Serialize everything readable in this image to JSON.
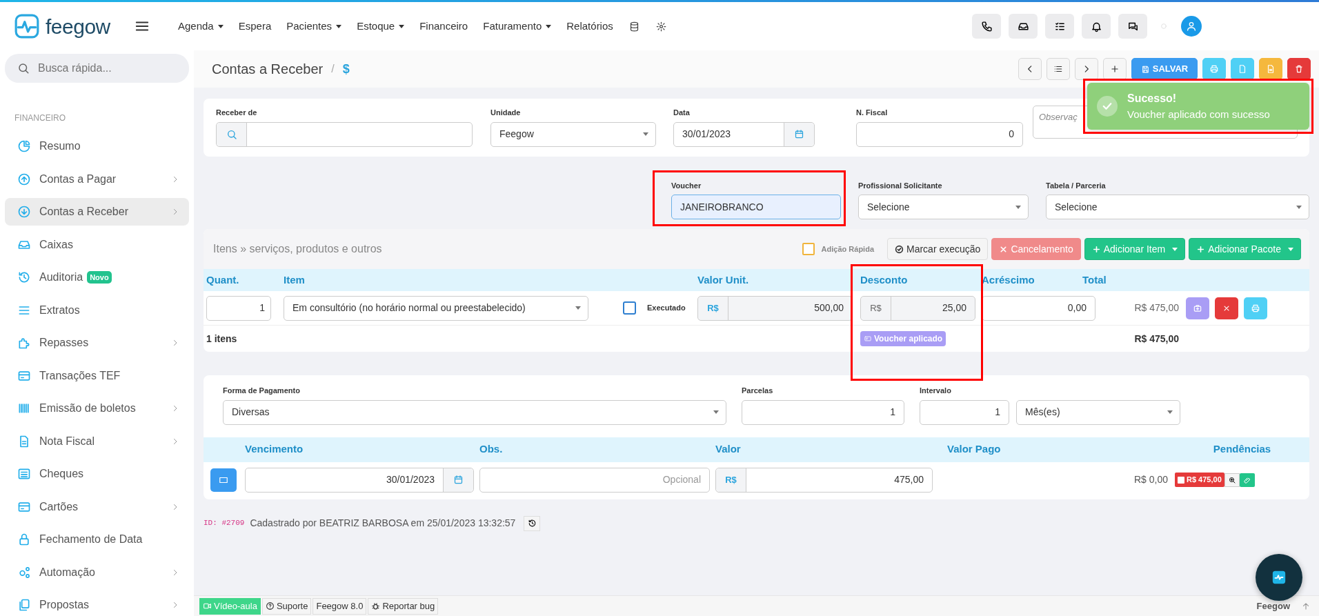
{
  "brand": {
    "name": "feegow"
  },
  "topnav": [
    {
      "label": "Agenda",
      "dropdown": true
    },
    {
      "label": "Espera",
      "dropdown": false
    },
    {
      "label": "Pacientes",
      "dropdown": true
    },
    {
      "label": "Estoque",
      "dropdown": true
    },
    {
      "label": "Financeiro",
      "dropdown": false
    },
    {
      "label": "Faturamento",
      "dropdown": true
    },
    {
      "label": "Relatórios",
      "dropdown": false
    }
  ],
  "search": {
    "placeholder": "Busca rápida..."
  },
  "sidebar": {
    "section": "FINANCEIRO",
    "items": [
      {
        "label": "Resumo",
        "submenu": false,
        "selected": false
      },
      {
        "label": "Contas a Pagar",
        "submenu": true,
        "selected": false
      },
      {
        "label": "Contas a Receber",
        "submenu": true,
        "selected": true
      },
      {
        "label": "Caixas",
        "submenu": false,
        "selected": false
      },
      {
        "label": "Auditoria",
        "badge": "Novo",
        "submenu": false,
        "selected": false
      },
      {
        "label": "Extratos",
        "submenu": false,
        "selected": false
      },
      {
        "label": "Repasses",
        "submenu": true,
        "selected": false
      },
      {
        "label": "Transações TEF",
        "submenu": false,
        "selected": false
      },
      {
        "label": "Emissão de boletos",
        "submenu": true,
        "selected": false
      },
      {
        "label": "Nota Fiscal",
        "submenu": true,
        "selected": false
      },
      {
        "label": "Cheques",
        "submenu": false,
        "selected": false
      },
      {
        "label": "Cartões",
        "submenu": true,
        "selected": false
      },
      {
        "label": "Fechamento de Data",
        "submenu": false,
        "selected": false
      },
      {
        "label": "Automação",
        "submenu": true,
        "selected": false
      },
      {
        "label": "Propostas",
        "submenu": true,
        "selected": false
      }
    ]
  },
  "page": {
    "title": "Contas a Receber",
    "separator": "/",
    "symbol": "$",
    "save_label": "SALVAR"
  },
  "toast": {
    "title": "Sucesso!",
    "message": "Voucher aplicado com sucesso",
    "highlighted": true
  },
  "header_fields": [
    {
      "label": "Receber de",
      "kind": "search"
    },
    {
      "label": "Unidade",
      "kind": "select",
      "value": "Feegow"
    },
    {
      "label": "Data",
      "kind": "date",
      "value": "30/01/2023"
    },
    {
      "label": "N. Fiscal",
      "kind": "number",
      "value": "0"
    },
    {
      "kind": "textarea",
      "placeholder": "Observaç"
    }
  ],
  "extra_fields": [
    {
      "label": "Voucher",
      "kind": "text",
      "value": "JANEIROBRANCO",
      "highlighted": true
    },
    {
      "label": "Profissional Solicitante",
      "kind": "select",
      "value": "Selecione",
      "highlighted": false
    },
    {
      "label": "Tabela / Parceria",
      "kind": "select",
      "value": "Selecione",
      "highlighted": false
    }
  ],
  "items": {
    "title": "Itens » serviços, produtos e outros",
    "quick_add": {
      "label": "Adição Rápida",
      "checked": false
    },
    "buttons": [
      {
        "label": "Marcar execução",
        "kind": "light"
      },
      {
        "label": "Cancelamento",
        "kind": "danger"
      },
      {
        "label": "Adicionar Item",
        "kind": "success"
      },
      {
        "label": "Adicionar Pacote",
        "kind": "success"
      }
    ],
    "columns": [
      {
        "label": "Quant.",
        "highlighted": false
      },
      {
        "label": "Item",
        "highlighted": false
      },
      {
        "label": "Valor Unit.",
        "highlighted": false
      },
      {
        "label": "Desconto",
        "highlighted": true
      },
      {
        "label": "Acréscimo",
        "highlighted": false
      },
      {
        "label": "Total",
        "highlighted": false
      }
    ],
    "rows": [
      {
        "quantity": "1",
        "item": "Em consultório (no horário normal ou preestabelecido)",
        "executed": {
          "label": "Executado",
          "checked": false
        },
        "unit_currency": "R$",
        "unit_value": "500,00",
        "discount_currency": "R$",
        "discount": "25,00",
        "surcharge": "0,00",
        "total": "R$ 475,00"
      }
    ],
    "count": "1 itens",
    "voucher_badge": "Voucher aplicado",
    "grand_total": "R$ 475,00"
  },
  "payment": {
    "fields": [
      {
        "label": "Forma de Pagamento",
        "kind": "select",
        "value": "Diversas"
      },
      {
        "label": "Parcelas",
        "kind": "number",
        "value": "1"
      },
      {
        "label": "Intervalo",
        "kind": "number",
        "value": "1"
      },
      {
        "kind": "select",
        "value": "Mês(es)"
      }
    ],
    "columns": [
      "Vencimento",
      "Obs.",
      "Valor",
      "Valor Pago",
      "Pendências"
    ],
    "rows": [
      {
        "due": "30/01/2023",
        "obs_placeholder": "Opcional",
        "currency": "R$",
        "value": "475,00",
        "paid": "R$ 0,00",
        "pending": "R$ 475,00"
      }
    ]
  },
  "record": {
    "id": "ID: #2709",
    "text": "Cadastrado por BEATRIZ BARBOSA em 25/01/2023 13:32:57"
  },
  "footer": {
    "links": [
      {
        "label": "Vídeo-aula",
        "kind": "video"
      },
      {
        "label": "Suporte",
        "kind": "help"
      },
      {
        "label": "Feegow 8.0",
        "kind": "plain"
      },
      {
        "label": "Reportar bug",
        "kind": "bug"
      }
    ],
    "brand": "Feegow"
  }
}
